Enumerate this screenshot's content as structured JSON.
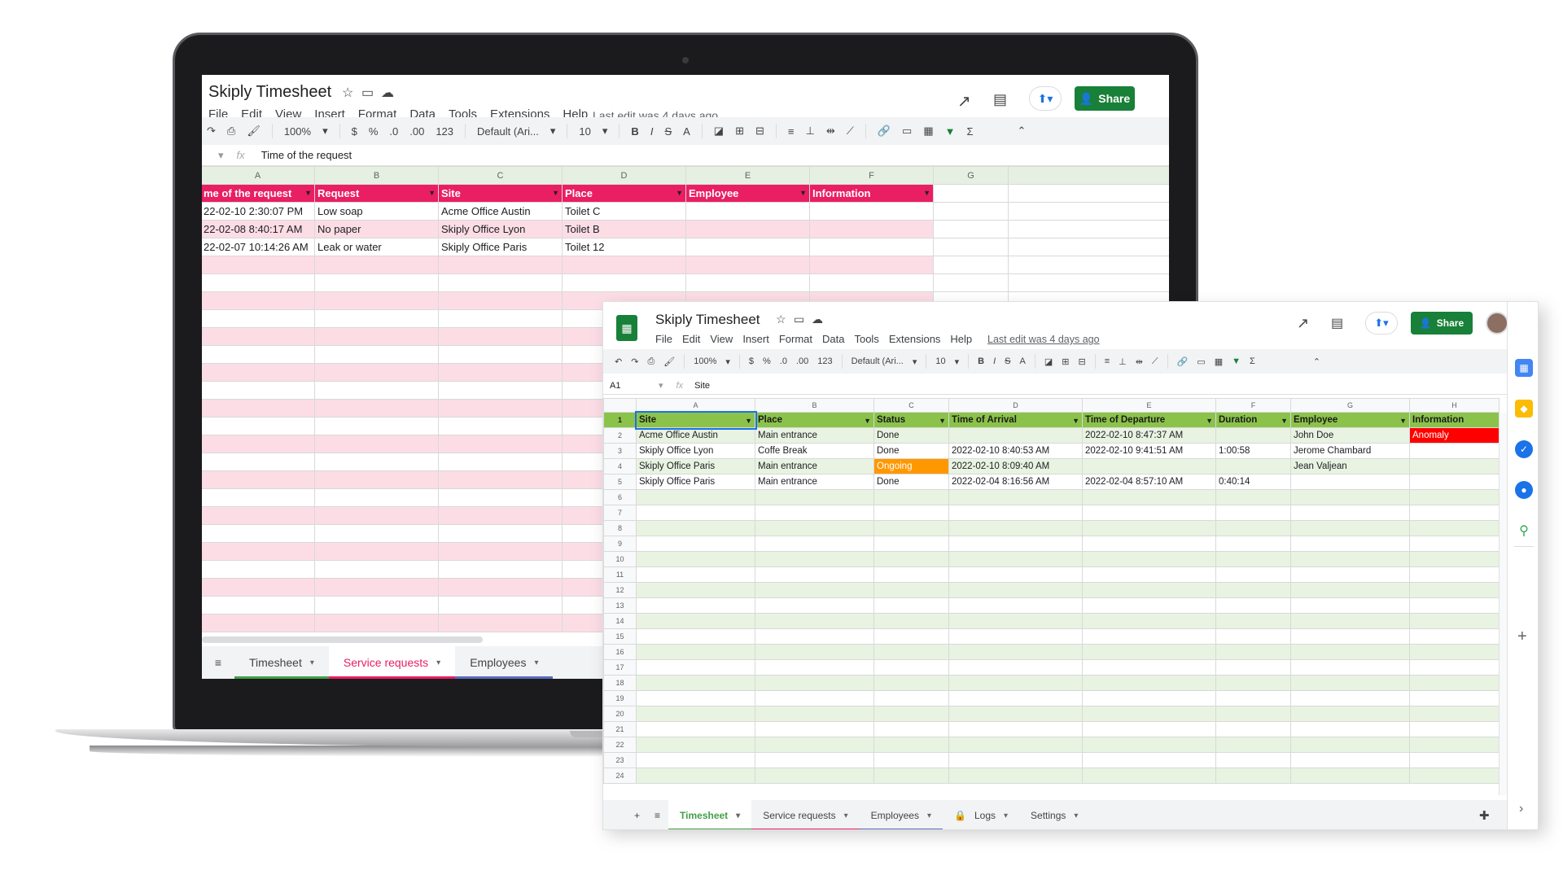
{
  "laptop_sheet": {
    "title": "Skiply Timesheet",
    "menu": [
      "File",
      "Edit",
      "View",
      "Insert",
      "Format",
      "Data",
      "Tools",
      "Extensions",
      "Help"
    ],
    "last_edit": "Last edit was 4 days ago",
    "share_label": "Share",
    "toolbar": {
      "zoom": "100%",
      "currency": "$",
      "percent": "%",
      "dec_less": ".0",
      "dec_more": ".00",
      "more_formats": "123",
      "font": "Default (Ari...",
      "font_size": "10"
    },
    "formula_value": "Time of the request",
    "columns": [
      "A",
      "B",
      "C",
      "D",
      "E",
      "F",
      "G"
    ],
    "header": [
      "me of the request",
      "Request",
      "Site",
      "Place",
      "Employee",
      "Information",
      ""
    ],
    "rows": [
      [
        "22-02-10 2:30:07 PM",
        "Low soap",
        "Acme Office Austin",
        "Toilet C",
        "",
        "",
        ""
      ],
      [
        "22-02-08 8:40:17 AM",
        "No paper",
        "Skiply Office Lyon",
        "Toilet B",
        "",
        "",
        ""
      ],
      [
        "22-02-07 10:14:26 AM",
        "Leak or water",
        "Skiply Office Paris",
        "Toilet 12",
        "",
        "",
        ""
      ]
    ],
    "tabs": [
      {
        "label": "Timesheet",
        "color": "#43a047",
        "active": false
      },
      {
        "label": "Service requests",
        "color": "#e91e63",
        "active": true
      },
      {
        "label": "Employees",
        "color": "#5c6bc0",
        "active": false
      }
    ]
  },
  "front_sheet": {
    "title": "Skiply Timesheet",
    "menu": [
      "File",
      "Edit",
      "View",
      "Insert",
      "Format",
      "Data",
      "Tools",
      "Extensions",
      "Help"
    ],
    "last_edit": "Last edit was 4 days ago",
    "share_label": "Share",
    "toolbar": {
      "zoom": "100%",
      "currency": "$",
      "percent": "%",
      "dec_less": ".0",
      "dec_more": ".00",
      "more_formats": "123",
      "font": "Default (Ari...",
      "font_size": "10"
    },
    "cell_ref": "A1",
    "formula_value": "Site",
    "columns": [
      "A",
      "B",
      "C",
      "D",
      "E",
      "F",
      "G",
      "H"
    ],
    "header": [
      "Site",
      "Place",
      "Status",
      "Time of Arrival",
      "Time of Departure",
      "Duration",
      "Employee",
      "Information"
    ],
    "rows": [
      [
        "Acme Office Austin",
        "Main entrance",
        "Done",
        "",
        "2022-02-10 8:47:37 AM",
        "",
        "John Doe",
        "Anomaly"
      ],
      [
        "Skiply Office Lyon",
        "Coffe Break",
        "Done",
        "2022-02-10 8:40:53 AM",
        "2022-02-10 9:41:51 AM",
        "1:00:58",
        "Jerome Chambard",
        ""
      ],
      [
        "Skiply Office Paris",
        "Main entrance",
        "Ongoing",
        "2022-02-10 8:09:40 AM",
        "",
        "",
        "Jean Valjean",
        ""
      ],
      [
        "Skiply Office Paris",
        "Main entrance",
        "Done",
        "2022-02-04 8:16:56 AM",
        "2022-02-04 8:57:10 AM",
        "0:40:14",
        "",
        ""
      ]
    ],
    "row_numbers": [
      "1",
      "2",
      "3",
      "4",
      "5",
      "6",
      "7",
      "8",
      "9",
      "10",
      "11",
      "12",
      "13",
      "14",
      "15",
      "16",
      "17",
      "18",
      "19",
      "20",
      "21",
      "22",
      "23",
      "24"
    ],
    "tabs": [
      {
        "label": "Timesheet",
        "color": "#43a047",
        "active": true
      },
      {
        "label": "Service requests",
        "color": "#e91e63",
        "active": false
      },
      {
        "label": "Employees",
        "color": "#5c6bc0",
        "active": false
      },
      {
        "label": "Logs",
        "color": "",
        "active": false
      },
      {
        "label": "Settings",
        "color": "",
        "active": false
      }
    ],
    "colors": {
      "header_green": "#8bc34a",
      "band_green": "#e8f3e1",
      "anomaly": "#ff0000",
      "ongoing": "#ff9800"
    }
  }
}
